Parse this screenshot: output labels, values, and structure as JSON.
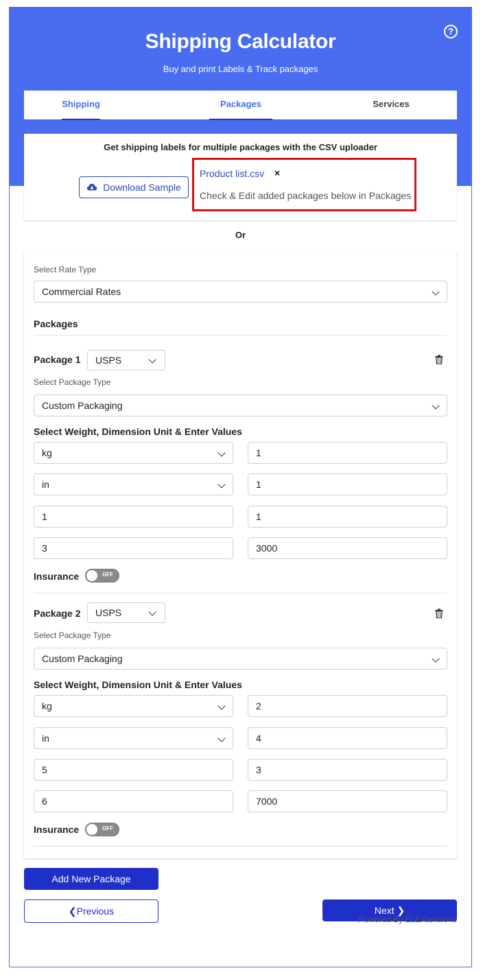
{
  "header": {
    "title": "Shipping Calculator",
    "subtitle": "Buy and print Labels & Track packages",
    "help_icon": "help-circle-icon"
  },
  "tabs": [
    {
      "label": "Shipping",
      "state": "completed"
    },
    {
      "label": "Packages",
      "state": "active"
    },
    {
      "label": "Services",
      "state": "inactive"
    }
  ],
  "csv": {
    "heading": "Get shipping labels for multiple packages with the CSV uploader",
    "download_label": "Download Sample",
    "file_name": "Product list.csv",
    "close_glyph": "×",
    "hint": "Check & Edit added packages below in Packages"
  },
  "or_label": "Or",
  "rate": {
    "label": "Select Rate Type",
    "value": "Commercial Rates"
  },
  "packages_heading": "Packages",
  "packages": [
    {
      "label": "Package 1",
      "carrier": "USPS",
      "type_label": "Select Package Type",
      "type_value": "Custom Packaging",
      "units_label": "Select Weight, Dimension Unit & Enter Values",
      "weight_unit": "kg",
      "weight_value": "1",
      "dimension_unit": "in",
      "length": "1",
      "width": "1",
      "height": "1",
      "extra_left": "3",
      "extra_right": "3000",
      "insurance_label": "Insurance",
      "insurance_state": "OFF"
    },
    {
      "label": "Package 2",
      "carrier": "USPS",
      "type_label": "Select Package Type",
      "type_value": "Custom Packaging",
      "units_label": "Select Weight, Dimension Unit & Enter Values",
      "weight_unit": "kg",
      "weight_value": "2",
      "dimension_unit": "in",
      "length": "4",
      "width": "5",
      "height": "3",
      "extra_left": "6",
      "extra_right": "7000",
      "insurance_label": "Insurance",
      "insurance_state": "OFF"
    }
  ],
  "actions": {
    "add_package": "Add New Package",
    "previous": "❮Previous",
    "next": "Next ❯"
  },
  "footer": {
    "powered": "Powered By ELEXtensions"
  },
  "colors": {
    "brand": "#4a6cf0",
    "primary_button": "#1f2fc9",
    "highlight_box": "#e01010"
  }
}
